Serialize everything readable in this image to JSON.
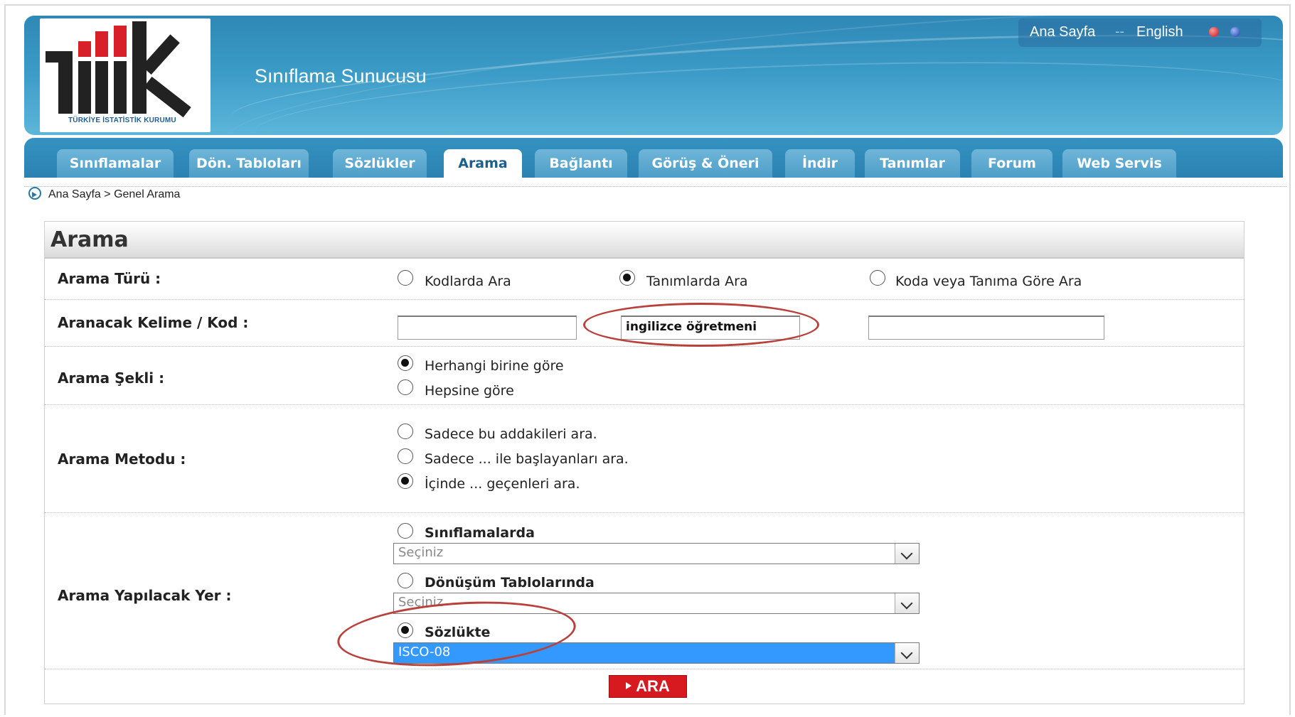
{
  "header": {
    "app_title": "Sınıflama Sunucusu",
    "logo_caption": "TÜRKİYE İSTATİSTİK KURUMU",
    "links": {
      "home": "Ana Sayfa",
      "separator": "--",
      "english": "English"
    }
  },
  "tabs": [
    {
      "label": "Sınıflamalar",
      "active": false
    },
    {
      "label": "Dön. Tabloları",
      "active": false
    },
    {
      "label": "Sözlükler",
      "active": false
    },
    {
      "label": "Arama",
      "active": true
    },
    {
      "label": "Bağlantı",
      "active": false
    },
    {
      "label": "Görüş & Öneri",
      "active": false
    },
    {
      "label": "İndir",
      "active": false
    },
    {
      "label": "Tanımlar",
      "active": false
    },
    {
      "label": "Forum",
      "active": false
    },
    {
      "label": "Web Servis",
      "active": false
    }
  ],
  "breadcrumb": "Ana Sayfa > Genel Arama",
  "panel": {
    "title": "Arama",
    "search_type": {
      "label": "Arama Türü :",
      "options": [
        "Kodlarda Ara",
        "Tanımlarda Ara",
        "Koda veya Tanıma Göre Ara"
      ],
      "selected": "Tanımlarda Ara"
    },
    "keyword": {
      "label": "Aranacak Kelime / Kod :",
      "values": [
        "",
        "ingilizce öğretmeni",
        ""
      ]
    },
    "search_mode": {
      "label": "Arama Şekli :",
      "options": [
        "Herhangi birine göre",
        "Hepsine göre"
      ],
      "selected": "Herhangi birine göre"
    },
    "search_method": {
      "label": "Arama Metodu :",
      "options": [
        "Sadece bu addakileri ara.",
        "Sadece ... ile başlayanları ara.",
        "İçinde ... geçenleri ara."
      ],
      "selected": "İçinde ... geçenleri ara."
    },
    "search_location": {
      "label": "Arama Yapılacak Yer :",
      "options": [
        {
          "label": "Sınıflamalarda",
          "select_value": "Seçiniz"
        },
        {
          "label": "Dönüşüm Tablolarında",
          "select_value": "Seçiniz"
        },
        {
          "label": "Sözlükte",
          "select_value": "ISCO-08"
        }
      ],
      "selected": "Sözlükte"
    },
    "submit_label": "ARA"
  },
  "colors": {
    "header_blue": "#2f88b6",
    "button_red": "#d71920",
    "annotation": "#b8413b",
    "select_highlight": "#3399ff"
  }
}
